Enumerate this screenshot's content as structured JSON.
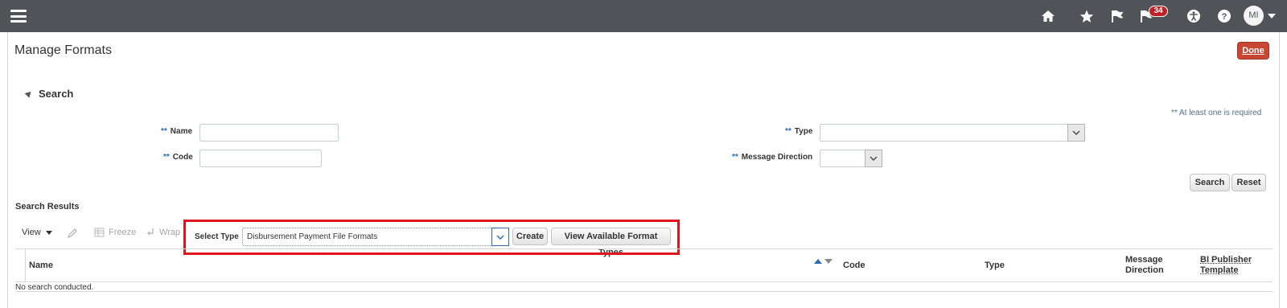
{
  "topbar": {
    "icons": [
      "hamburger-menu-icon",
      "home-icon",
      "favorites-star-icon",
      "flag-icon",
      "notifications-icon",
      "accessibility-icon",
      "help-icon"
    ],
    "notification_count": "34",
    "avatar_initials": "MI"
  },
  "page": {
    "title": "Manage Formats",
    "done_label": "Done"
  },
  "search": {
    "header": "Search",
    "required_note": "** At least one is required",
    "required_marker": "**",
    "fields": {
      "name_label": "Name",
      "code_label": "Code",
      "type_label": "Type",
      "message_direction_label": "Message Direction"
    },
    "search_button": "Search",
    "reset_button": "Reset"
  },
  "results": {
    "title": "Search Results",
    "toolbar": {
      "view": "View",
      "freeze": "Freeze",
      "wrap": "Wrap",
      "select_type_label": "Select Type",
      "select_type_value": "Disbursement Payment File Formats",
      "create": "Create",
      "view_available": "View Available Format Types"
    },
    "columns": {
      "name": "Name",
      "code": "Code",
      "type": "Type",
      "message_direction_line1": "Message",
      "message_direction_line2": "Direction",
      "bi_publisher_line1": "BI Publisher",
      "bi_publisher_line2": "Template"
    },
    "empty_message": "No search conducted."
  },
  "colors": {
    "topbar": "#505459",
    "done_button": "#c74634",
    "highlight_box": "#e0161e",
    "required_star": "#2b6cb0"
  }
}
